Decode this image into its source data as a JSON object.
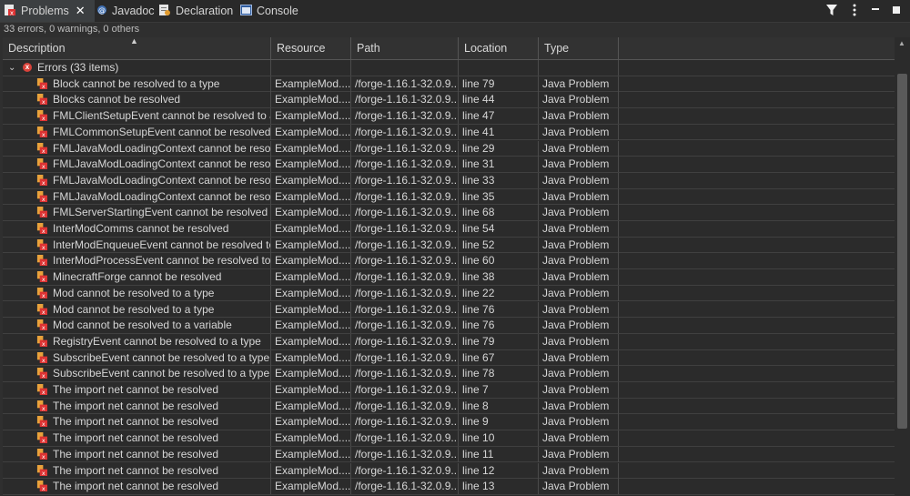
{
  "tabs": [
    {
      "label": "Problems",
      "active": true,
      "icon": "problems-icon"
    },
    {
      "label": "Javadoc",
      "active": false,
      "icon": "javadoc-icon"
    },
    {
      "label": "Declaration",
      "active": false,
      "icon": "declaration-icon"
    },
    {
      "label": "Console",
      "active": false,
      "icon": "console-icon"
    }
  ],
  "toolbar": {
    "filter_icon": "filter-icon",
    "menu_icon": "view-menu-icon",
    "minimize_icon": "minimize-icon",
    "maximize_icon": "maximize-icon"
  },
  "summary": "33 errors, 0 warnings, 0 others",
  "columns": [
    "Description",
    "Resource",
    "Path",
    "Location",
    "Type"
  ],
  "group": {
    "label": "Errors (33 items)"
  },
  "rows": [
    {
      "description": "Block cannot be resolved to a type",
      "resource": "ExampleMod....",
      "path": "/forge-1.16.1-32.0.9...",
      "location": "line 79",
      "type": "Java Problem"
    },
    {
      "description": "Blocks cannot be resolved",
      "resource": "ExampleMod....",
      "path": "/forge-1.16.1-32.0.9...",
      "location": "line 44",
      "type": "Java Problem"
    },
    {
      "description": "FMLClientSetupEvent cannot be resolved to a",
      "resource": "ExampleMod....",
      "path": "/forge-1.16.1-32.0.9...",
      "location": "line 47",
      "type": "Java Problem"
    },
    {
      "description": "FMLCommonSetupEvent cannot be resolved t",
      "resource": "ExampleMod....",
      "path": "/forge-1.16.1-32.0.9...",
      "location": "line 41",
      "type": "Java Problem"
    },
    {
      "description": "FMLJavaModLoadingContext cannot be resolv",
      "resource": "ExampleMod....",
      "path": "/forge-1.16.1-32.0.9...",
      "location": "line 29",
      "type": "Java Problem"
    },
    {
      "description": "FMLJavaModLoadingContext cannot be resolv",
      "resource": "ExampleMod....",
      "path": "/forge-1.16.1-32.0.9...",
      "location": "line 31",
      "type": "Java Problem"
    },
    {
      "description": "FMLJavaModLoadingContext cannot be resolv",
      "resource": "ExampleMod....",
      "path": "/forge-1.16.1-32.0.9...",
      "location": "line 33",
      "type": "Java Problem"
    },
    {
      "description": "FMLJavaModLoadingContext cannot be resolv",
      "resource": "ExampleMod....",
      "path": "/forge-1.16.1-32.0.9...",
      "location": "line 35",
      "type": "Java Problem"
    },
    {
      "description": "FMLServerStartingEvent cannot be resolved to",
      "resource": "ExampleMod....",
      "path": "/forge-1.16.1-32.0.9...",
      "location": "line 68",
      "type": "Java Problem"
    },
    {
      "description": "InterModComms cannot be resolved",
      "resource": "ExampleMod....",
      "path": "/forge-1.16.1-32.0.9...",
      "location": "line 54",
      "type": "Java Problem"
    },
    {
      "description": "InterModEnqueueEvent cannot be resolved to",
      "resource": "ExampleMod....",
      "path": "/forge-1.16.1-32.0.9...",
      "location": "line 52",
      "type": "Java Problem"
    },
    {
      "description": "InterModProcessEvent cannot be resolved to a",
      "resource": "ExampleMod....",
      "path": "/forge-1.16.1-32.0.9...",
      "location": "line 60",
      "type": "Java Problem"
    },
    {
      "description": "MinecraftForge cannot be resolved",
      "resource": "ExampleMod....",
      "path": "/forge-1.16.1-32.0.9...",
      "location": "line 38",
      "type": "Java Problem"
    },
    {
      "description": "Mod cannot be resolved to a type",
      "resource": "ExampleMod....",
      "path": "/forge-1.16.1-32.0.9...",
      "location": "line 22",
      "type": "Java Problem"
    },
    {
      "description": "Mod cannot be resolved to a type",
      "resource": "ExampleMod....",
      "path": "/forge-1.16.1-32.0.9...",
      "location": "line 76",
      "type": "Java Problem"
    },
    {
      "description": "Mod cannot be resolved to a variable",
      "resource": "ExampleMod....",
      "path": "/forge-1.16.1-32.0.9...",
      "location": "line 76",
      "type": "Java Problem"
    },
    {
      "description": "RegistryEvent cannot be resolved to a type",
      "resource": "ExampleMod....",
      "path": "/forge-1.16.1-32.0.9...",
      "location": "line 79",
      "type": "Java Problem"
    },
    {
      "description": "SubscribeEvent cannot be resolved to a type",
      "resource": "ExampleMod....",
      "path": "/forge-1.16.1-32.0.9...",
      "location": "line 67",
      "type": "Java Problem"
    },
    {
      "description": "SubscribeEvent cannot be resolved to a type",
      "resource": "ExampleMod....",
      "path": "/forge-1.16.1-32.0.9...",
      "location": "line 78",
      "type": "Java Problem"
    },
    {
      "description": "The import net cannot be resolved",
      "resource": "ExampleMod....",
      "path": "/forge-1.16.1-32.0.9...",
      "location": "line 7",
      "type": "Java Problem"
    },
    {
      "description": "The import net cannot be resolved",
      "resource": "ExampleMod....",
      "path": "/forge-1.16.1-32.0.9...",
      "location": "line 8",
      "type": "Java Problem"
    },
    {
      "description": "The import net cannot be resolved",
      "resource": "ExampleMod....",
      "path": "/forge-1.16.1-32.0.9...",
      "location": "line 9",
      "type": "Java Problem"
    },
    {
      "description": "The import net cannot be resolved",
      "resource": "ExampleMod....",
      "path": "/forge-1.16.1-32.0.9...",
      "location": "line 10",
      "type": "Java Problem"
    },
    {
      "description": "The import net cannot be resolved",
      "resource": "ExampleMod....",
      "path": "/forge-1.16.1-32.0.9...",
      "location": "line 11",
      "type": "Java Problem"
    },
    {
      "description": "The import net cannot be resolved",
      "resource": "ExampleMod....",
      "path": "/forge-1.16.1-32.0.9...",
      "location": "line 12",
      "type": "Java Problem"
    },
    {
      "description": "The import net cannot be resolved",
      "resource": "ExampleMod....",
      "path": "/forge-1.16.1-32.0.9...",
      "location": "line 13",
      "type": "Java Problem"
    }
  ]
}
